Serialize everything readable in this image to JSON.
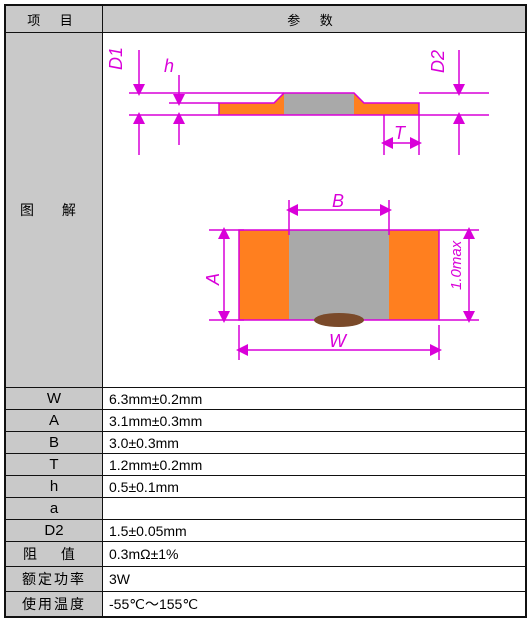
{
  "header": {
    "col1": "项 目",
    "col2": "参 数"
  },
  "diagram_label": "图 解",
  "dims": {
    "d1": "D1",
    "d2": "D2",
    "h": "h",
    "t": "T",
    "b": "B",
    "a": "A",
    "w": "W",
    "note": "1.0max"
  },
  "rows": [
    {
      "name": "W",
      "cn": false,
      "value": "6.3mm±0.2mm"
    },
    {
      "name": "A",
      "cn": false,
      "value": "3.1mm±0.3mm"
    },
    {
      "name": "B",
      "cn": false,
      "value": "3.0±0.3mm"
    },
    {
      "name": "T",
      "cn": false,
      "value": "1.2mm±0.2mm"
    },
    {
      "name": "h",
      "cn": false,
      "value": "0.5±0.1mm"
    },
    {
      "name": "a",
      "cn": false,
      "value": ""
    },
    {
      "name": "D2",
      "cn": false,
      "value": "1.5±0.05mm"
    },
    {
      "name": "阻 值",
      "cn": true,
      "value": "0.3mΩ±1%"
    },
    {
      "name": "额定功率",
      "cn": true,
      "value": "3W"
    },
    {
      "name": "使用温度",
      "cn": true,
      "value": "-55℃～155℃"
    }
  ]
}
